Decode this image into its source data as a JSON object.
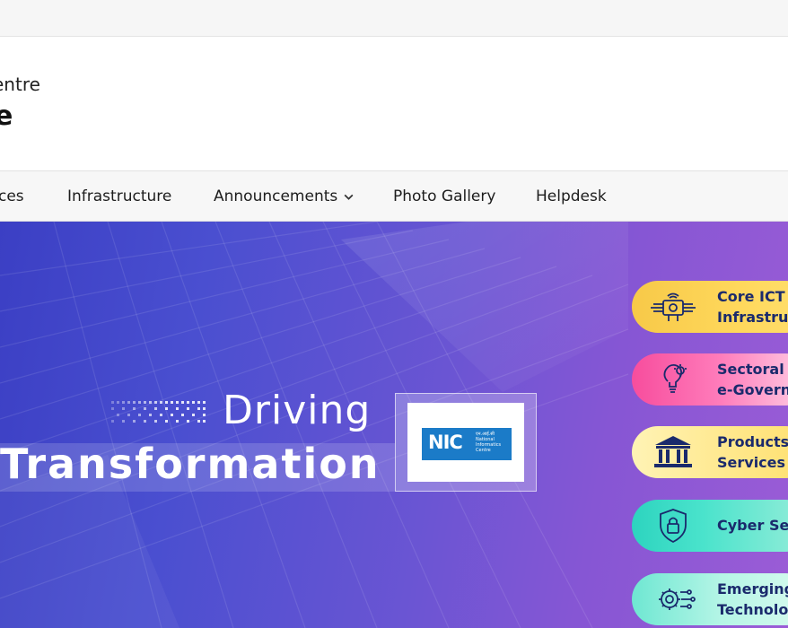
{
  "brand": {
    "line1": "entre",
    "line2": "e"
  },
  "nav": {
    "items": [
      {
        "label": "ces"
      },
      {
        "label": "Infrastructure"
      },
      {
        "label": "Announcements"
      },
      {
        "label": "Photo Gallery"
      },
      {
        "label": "Helpdesk"
      }
    ]
  },
  "banner": {
    "line1": "Driving",
    "line2": "Transformation",
    "logo": {
      "text": "NIC",
      "hindi": "एन.आई.सी",
      "sub": "National Informatics Centre"
    },
    "pills": [
      {
        "line1": "Core ICT",
        "line2": "Infrastruc",
        "icon": "circuit-chip-icon",
        "color": "#f7c948"
      },
      {
        "line1": "Sectoral",
        "line2": "e-Govern",
        "icon": "lightbulb-gear-icon",
        "color": "#f74d9d"
      },
      {
        "line1": "Products",
        "line2": "Services",
        "icon": "government-building-icon",
        "color": "#ffe789"
      },
      {
        "line1": "Cyber Sec",
        "icon": "shield-lock-icon",
        "color": "#2dd4bf"
      },
      {
        "line1": "Emerging",
        "line2": "Technolo",
        "icon": "gear-network-icon",
        "color": "#6ee7d2"
      }
    ]
  }
}
